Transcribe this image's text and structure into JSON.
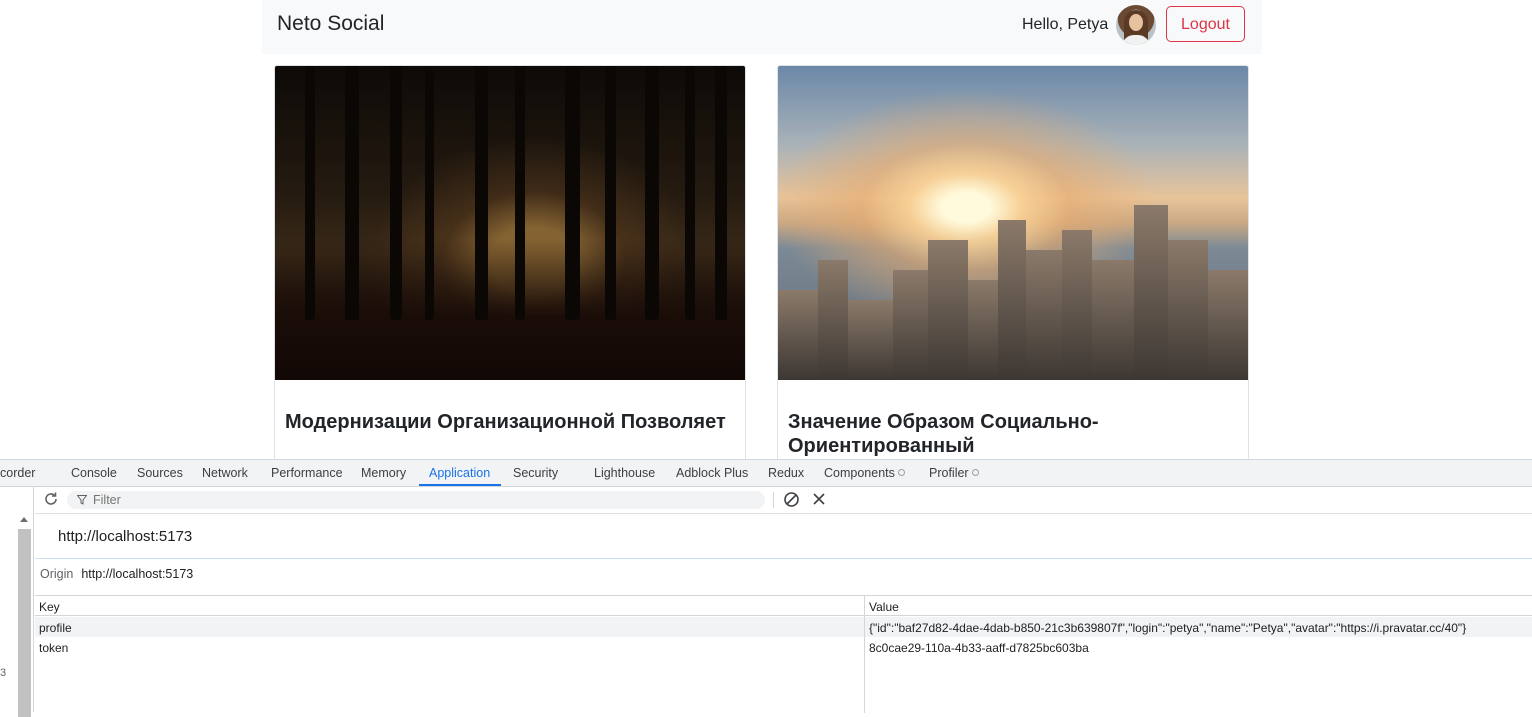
{
  "navbar": {
    "brand": "Neto Social",
    "greeting": "Hello, Petya",
    "logout_label": "Logout"
  },
  "posts": [
    {
      "title": "Модернизации Организационной Позволяет"
    },
    {
      "title": "Значение Образом Социально-Ориентированный"
    }
  ],
  "devtools": {
    "tabs": [
      {
        "label": "corder"
      },
      {
        "label": "Console"
      },
      {
        "label": "Sources"
      },
      {
        "label": "Network"
      },
      {
        "label": "Performance"
      },
      {
        "label": "Memory"
      },
      {
        "label": "Application"
      },
      {
        "label": "Security"
      },
      {
        "label": "Lighthouse"
      },
      {
        "label": "Adblock Plus"
      },
      {
        "label": "Redux"
      },
      {
        "label": "Components"
      },
      {
        "label": "Profiler"
      }
    ],
    "active_tab": "Application",
    "filter_placeholder": "Filter",
    "origin_heading": "http://localhost:5173",
    "origin_label": "Origin",
    "origin_value": "http://localhost:5173",
    "gutter_number": "3",
    "table": {
      "columns": [
        "Key",
        "Value"
      ],
      "rows": [
        {
          "key": "profile",
          "value": "{\"id\":\"baf27d82-4dae-4dab-b850-21c3b639807f\",\"login\":\"petya\",\"name\":\"Petya\",\"avatar\":\"https://i.pravatar.cc/40\"}"
        },
        {
          "key": "token",
          "value": "8c0cae29-110a-4b33-aaff-d7825bc603ba"
        }
      ]
    },
    "accent_color": "#1a73e8"
  },
  "colors": {
    "danger": "#dc3545",
    "navbar_bg": "#f8f9fa"
  }
}
